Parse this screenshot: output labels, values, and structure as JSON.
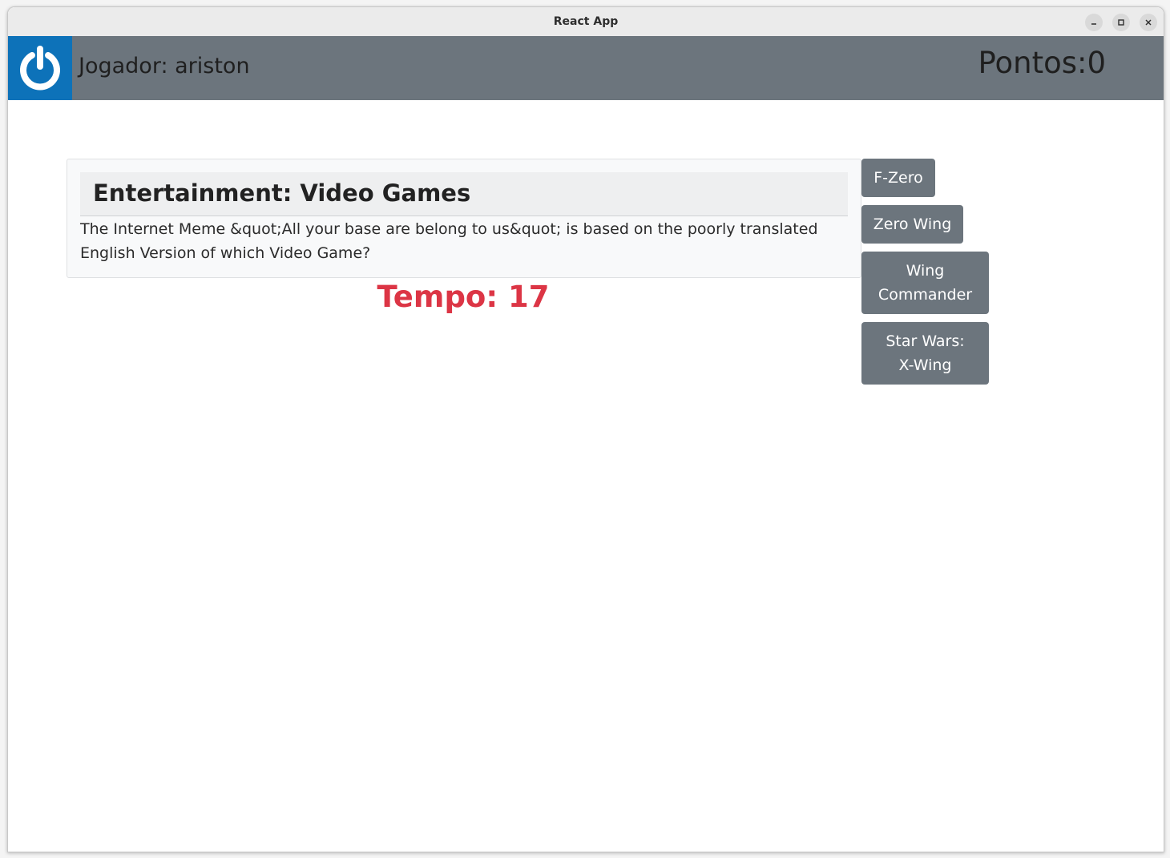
{
  "window": {
    "title": "React App"
  },
  "navbar": {
    "player_label": "Jogador: ariston",
    "score_label": "Pontos:0",
    "power_icon": "power-icon",
    "power_color": "#0d72b9",
    "bar_color": "#6c757d"
  },
  "question": {
    "category": "Entertainment: Video Games",
    "text": "The Internet Meme &quot;All your base are belong to us&quot; is based on the poorly translated English Version of which Video Game?"
  },
  "timer": {
    "label": "Tempo: 17",
    "color": "#dc3545"
  },
  "answers": [
    {
      "label": "F-Zero"
    },
    {
      "label": "Zero Wing"
    },
    {
      "label": "Wing Commander"
    },
    {
      "label": "Star Wars: X-Wing"
    }
  ]
}
